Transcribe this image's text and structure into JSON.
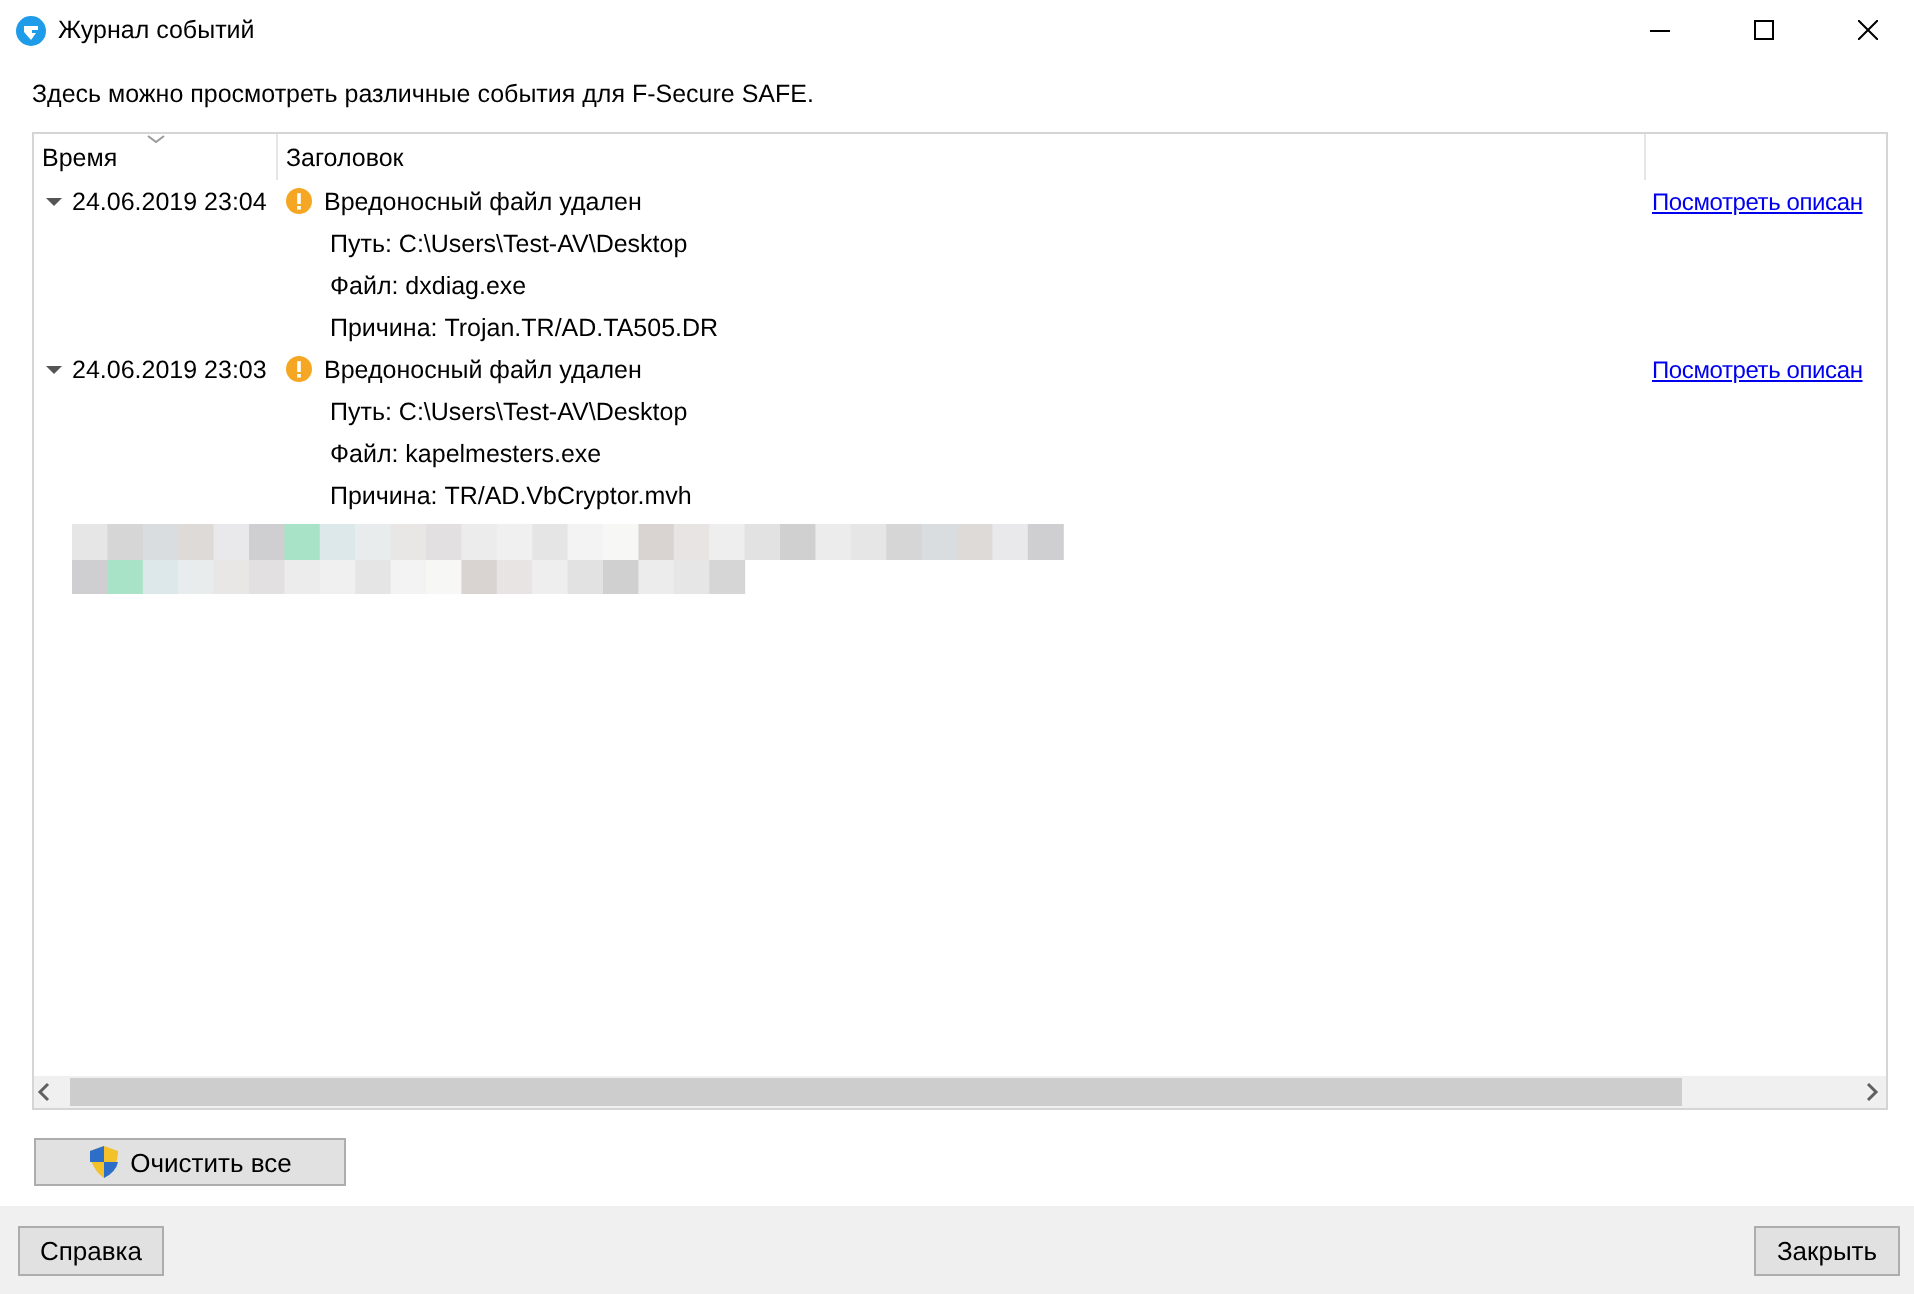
{
  "window": {
    "title": "Журнал событий"
  },
  "description": "Здесь можно просмотреть различные события для F-Secure SAFE.",
  "table": {
    "columns": [
      {
        "label": "Время",
        "sorted": true
      },
      {
        "label": "Заголовок",
        "sorted": false
      }
    ],
    "events": [
      {
        "time": "24.06.2019 23:04",
        "expanded": true,
        "kind": "warning",
        "title": "Вредоносный файл удален",
        "details": [
          "Путь: C:\\Users\\Test-AV\\Desktop",
          "Файл: dxdiag.exe",
          "Причина: Trojan.TR/AD.TA505.DR"
        ],
        "link": "Посмотреть описан"
      },
      {
        "time": "24.06.2019 23:03",
        "expanded": true,
        "kind": "warning",
        "title": "Вредоносный файл удален",
        "details": [
          "Путь: C:\\Users\\Test-AV\\Desktop",
          "Файл: kapelmesters.exe",
          "Причина: TR/AD.VbCryptor.mvh"
        ],
        "link": "Посмотреть описан"
      }
    ]
  },
  "clear_button": "Очистить все",
  "footer_buttons": [
    "Справка",
    "Закрыть"
  ]
}
